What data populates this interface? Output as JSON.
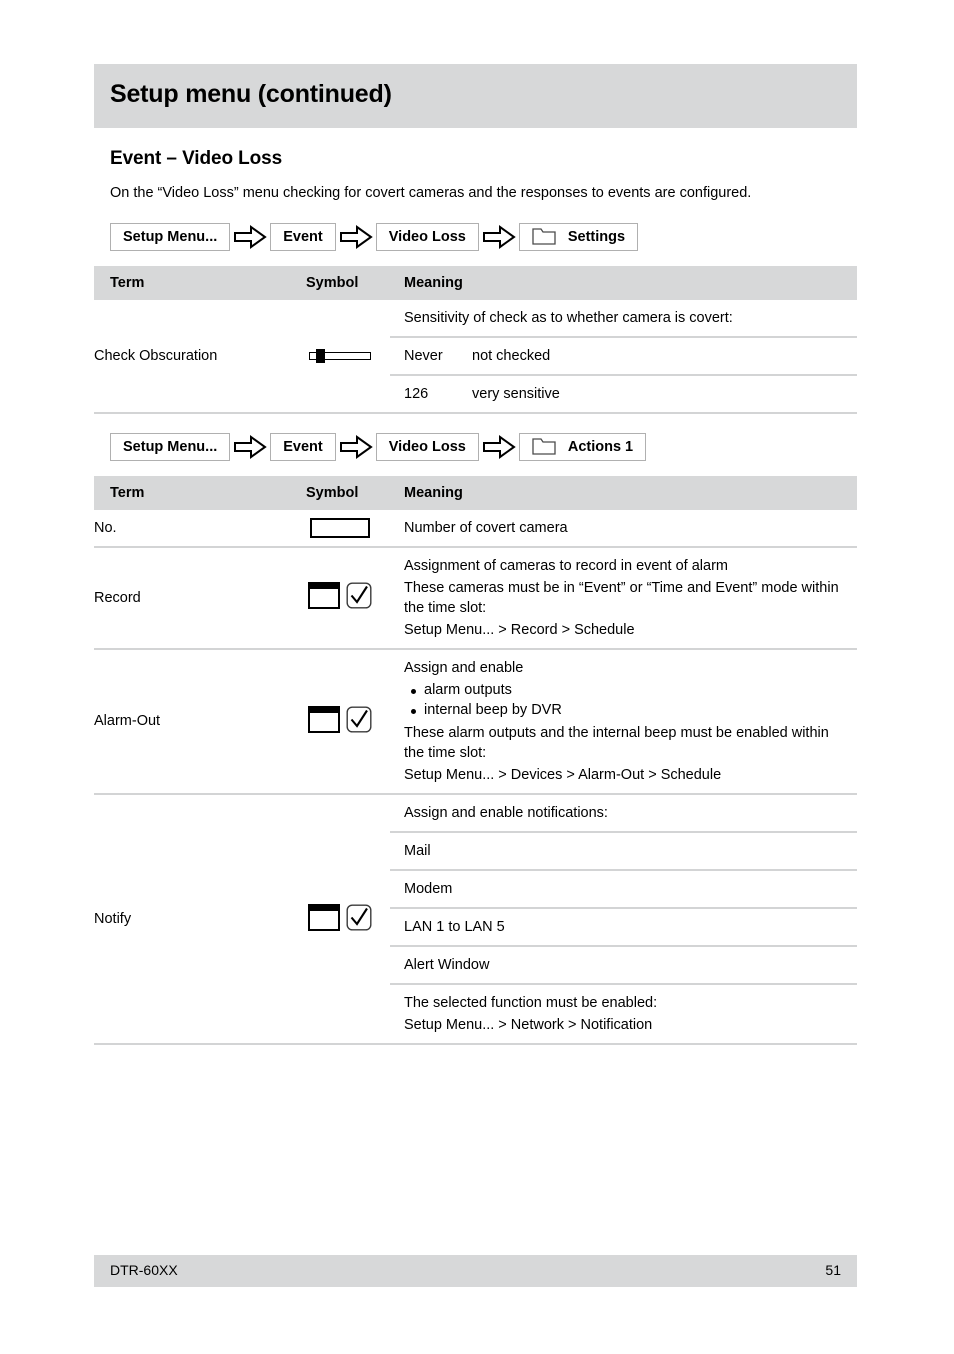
{
  "header": {
    "title": "Setup menu (continued)"
  },
  "section": {
    "heading": "Event – Video Loss",
    "intro": "On the “Video Loss” menu checking for covert cameras and the responses to events are configured."
  },
  "paths": {
    "settings": [
      "Setup Menu...",
      "Event",
      "Video Loss",
      "Settings"
    ],
    "actions": [
      "Setup Menu...",
      "Event",
      "Video Loss",
      "Actions 1"
    ]
  },
  "table_headers": {
    "term": "Term",
    "symbol": "Symbol",
    "meaning": "Meaning"
  },
  "table_settings": {
    "rows": [
      {
        "term": "Check Obscuration",
        "symbol": "slider-symbol",
        "intro": "Sensitivity of check as to whether camera is covert:",
        "values": [
          {
            "key": "Never",
            "value": "not checked"
          },
          {
            "key": "126",
            "value": "very sensitive"
          }
        ]
      }
    ]
  },
  "table_actions": {
    "rows": [
      {
        "term": "No.",
        "symbol": "text-field-symbol",
        "lines": [
          "Number of covert camera"
        ]
      },
      {
        "term": "Record",
        "symbol": "field-checkbox-symbol",
        "lines": [
          "Assignment of cameras to record in event of alarm",
          "These cameras must be in “Event” or “Time and Event” mode within the time slot:",
          "Setup Menu... > Record > Schedule"
        ]
      },
      {
        "term": "Alarm-Out",
        "symbol": "field-checkbox-symbol",
        "intro": "Assign and enable",
        "bullets": [
          "alarm outputs",
          "internal beep by DVR"
        ],
        "lines": [
          "These alarm outputs and the internal beep must be enabled within the time slot:",
          "Setup Menu... > Devices > Alarm-Out > Schedule"
        ]
      },
      {
        "term": "Notify",
        "symbol": "field-checkbox-symbol",
        "intro": "Assign and enable notifications:",
        "options": [
          "Mail",
          "Modem",
          "LAN 1 to LAN 5",
          "Alert Window"
        ],
        "lines": [
          "The selected function must be enabled:",
          "Setup Menu... > Network > Notification"
        ]
      }
    ]
  },
  "footer": {
    "model": "DTR-60XX",
    "page_number": "51"
  },
  "colors": {
    "band_gray": "#d7d8d9",
    "rule_gray": "#d3d4d5",
    "text": "#000000"
  }
}
